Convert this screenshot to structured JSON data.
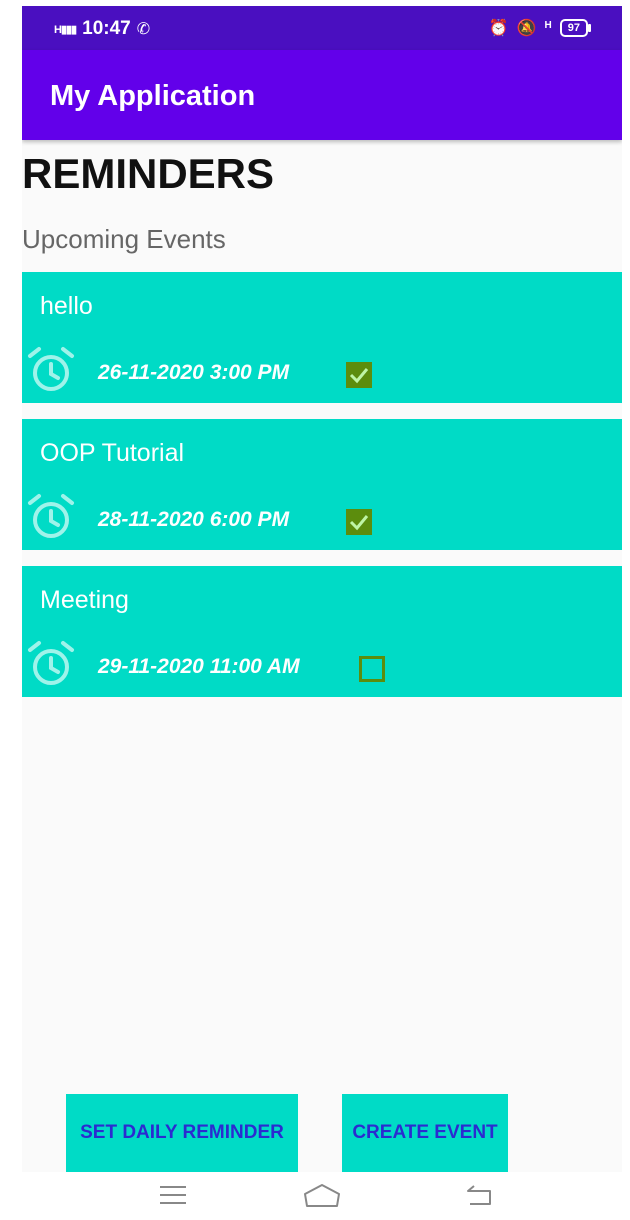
{
  "status_bar": {
    "network": "H",
    "time": "10:47",
    "right_network": "H",
    "battery": "97"
  },
  "app_bar": {
    "title": "My Application"
  },
  "page": {
    "heading": "REMINDERS",
    "subheading": "Upcoming Events"
  },
  "events": [
    {
      "title": "hello",
      "datetime": "26-11-2020 3:00 PM",
      "checked": true
    },
    {
      "title": "OOP Tutorial",
      "datetime": "28-11-2020 6:00 PM",
      "checked": true
    },
    {
      "title": "Meeting",
      "datetime": "29-11-2020 11:00 AM",
      "checked": false
    }
  ],
  "buttons": {
    "daily_reminder": "SET DAILY REMINDER",
    "create_event": "CREATE EVENT"
  },
  "colors": {
    "status_bar": "#4a0fc0",
    "app_bar": "#6200ea",
    "card": "#00dbc6",
    "checkbox": "#5c8d0d",
    "button_text": "#2b2bd0"
  },
  "icons": {
    "alarm": "alarm-clock-icon",
    "menu": "menu-icon",
    "home": "home-icon",
    "back": "back-icon"
  }
}
